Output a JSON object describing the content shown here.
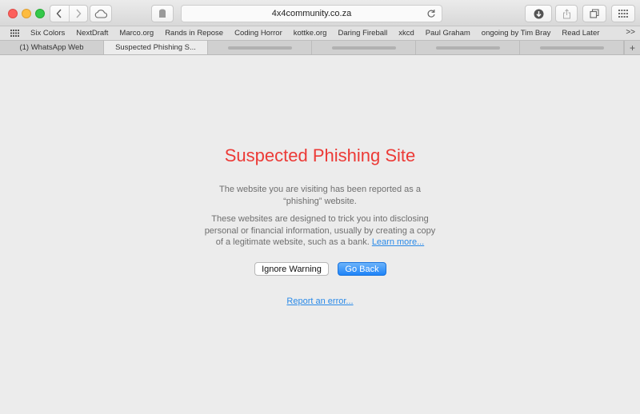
{
  "browser": {
    "address": "4x4community.co.za",
    "icons": [
      "back-icon",
      "forward-icon",
      "cloud-icon",
      "reader-icon",
      "reload-icon",
      "downloads-icon",
      "share-icon",
      "tabs-icon",
      "grid-icon"
    ]
  },
  "bookmarks": {
    "items": [
      "Six Colors",
      "NextDraft",
      "Marco.org",
      "Rands in Repose",
      "Coding Horror",
      "kottke.org",
      "Daring Fireball",
      "xkcd",
      "Paul Graham",
      "ongoing by Tim Bray",
      "Read Later"
    ],
    "more": ">>"
  },
  "tabs": {
    "items": [
      {
        "label": "(1) WhatsApp Web",
        "active": false
      },
      {
        "label": "Suspected Phishing S...",
        "active": true
      }
    ],
    "add": "+"
  },
  "warning": {
    "title": "Suspected Phishing Site",
    "paragraph1": "The website you are visiting has been reported as a “phishing” website.",
    "paragraph2": "These websites are designed to trick you into disclosing personal or financial information, usually by creating a copy of a legitimate website, such as a bank.",
    "learn_more": "Learn more...",
    "ignore_button": "Ignore Warning",
    "back_button": "Go Back",
    "report_link": "Report an error..."
  },
  "colors": {
    "title": "#ec3a36",
    "link": "#2a8ae8",
    "primary_button": "#1e83f7"
  }
}
